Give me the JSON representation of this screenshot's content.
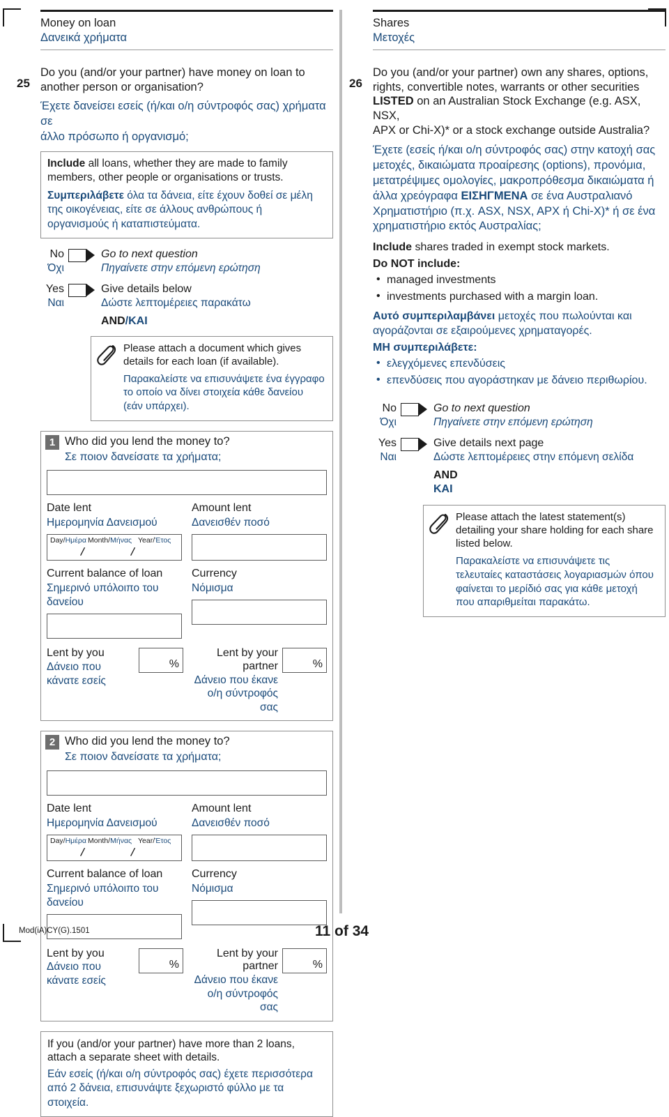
{
  "left": {
    "section": {
      "title_en": "Money on loan",
      "title_el": "Δανεικά χρήματα"
    },
    "question": {
      "number": "25",
      "text_en_1": "Do you (and/or your partner) have money on loan to",
      "text_en_2": "another person or organisation?",
      "text_el_1": "Έχετε δανείσει εσείς (ή/και ο/η σύντροφός σας) χρήματα σε",
      "text_el_2": "άλλο πρόσωπο ή οργανισμό;"
    },
    "include_box": {
      "en_bold": "Include",
      "en_rest": " all loans, whether they are made to family members, other people or organisations or trusts.",
      "el_bold": "Συμπεριλάβετε",
      "el_rest": " όλα τα δάνεια, είτε έχουν δοθεί σε μέλη της οικογένειας, είτε σε άλλους ανθρώπους ή οργανισμούς ή καταπιστεύματα."
    },
    "answers": {
      "no_en": "No",
      "no_el": "Όχι",
      "no_action_en": "Go to next question",
      "no_action_el": "Πηγαίνετε στην επόμενη ερώτηση",
      "yes_en": "Yes",
      "yes_el": "Ναι",
      "yes_action_en": "Give details below",
      "yes_action_el": "Δώστε λεπτομέρειες παρακάτω",
      "and_en": "AND",
      "and_el": "/ΚΑΙ"
    },
    "attach": {
      "icon": "paperclip-icon",
      "en": "Please attach a document which gives details for each loan (if available).",
      "el": "Παρακαλείστε να επισυνάψετε ένα έγγραφο το οποίο να δίνει στοιχεία κάθε δανείου (εάν υπάρχει)."
    },
    "entries": [
      {
        "badge": "1",
        "q_en": "Who did you lend the money to?",
        "q_el": "Σε ποιον δανείσατε τα χρήματα;",
        "recipient_value": "",
        "date_label_en": "Date lent",
        "date_label_el": "Ημερομηνία Δανεισμού",
        "day_en": "Day/",
        "day_el": "Ημέρα",
        "month_en": "Month/",
        "month_el": "Μήνας",
        "year_en": "Year/",
        "year_el": "Έτος",
        "date_value": "",
        "amount_label_en": "Amount lent",
        "amount_label_el": "Δανεισθέν ποσό",
        "amount_value": "",
        "balance_label_en": "Current balance of loan",
        "balance_label_el": "Σημερινό υπόλοιπο του δανείου",
        "balance_value": "",
        "currency_label_en": "Currency",
        "currency_label_el": "Νόμισμα",
        "currency_value": "",
        "lent_you_en": "Lent by you",
        "lent_you_el_1": "Δάνειο που",
        "lent_you_el_2": "κάνατε εσείς",
        "lent_you_value": "",
        "lent_partner_en": "Lent by your partner",
        "lent_partner_el_1": "Δάνειο που έκανε",
        "lent_partner_el_2": "ο/η σύντροφός σας",
        "lent_partner_value": "",
        "percent_symbol": "%"
      },
      {
        "badge": "2",
        "q_en": "Who did you lend the money to?",
        "q_el": "Σε ποιον δανείσατε τα χρήματα;",
        "recipient_value": "",
        "date_label_en": "Date lent",
        "date_label_el": "Ημερομηνία Δανεισμού",
        "day_en": "Day/",
        "day_el": "Ημέρα",
        "month_en": "Month/",
        "month_el": "Μήνας",
        "year_en": "Year/",
        "year_el": "Έτος",
        "date_value": "",
        "amount_label_en": "Amount lent",
        "amount_label_el": "Δανεισθέν ποσό",
        "amount_value": "",
        "balance_label_en": "Current balance of loan",
        "balance_label_el": "Σημερινό υπόλοιπο του δανείου",
        "balance_value": "",
        "currency_label_en": "Currency",
        "currency_label_el": "Νόμισμα",
        "currency_value": "",
        "lent_you_en": "Lent by you",
        "lent_you_el_1": "Δάνειο που",
        "lent_you_el_2": "κάνατε εσείς",
        "lent_you_value": "",
        "lent_partner_en": "Lent by your partner",
        "lent_partner_el_1": "Δάνειο που έκανε",
        "lent_partner_el_2": "ο/η σύντροφός σας",
        "lent_partner_value": "",
        "percent_symbol": "%"
      }
    ],
    "footnote": {
      "en": "If you (and/or your partner) have more than 2 loans, attach a separate sheet with details.",
      "el": "Εάν εσείς (ή/και ο/η σύντροφός σας) έχετε περισσότερα από 2 δάνεια, επισυνάψτε ξεχωριστό φύλλο με τα στοιχεία."
    }
  },
  "right": {
    "section": {
      "title_en": "Shares",
      "title_el": "Μετοχές"
    },
    "question": {
      "number": "26",
      "text_en_1": "Do you (and/or your partner) own any shares, options,",
      "text_en_2": "rights, convertible notes, warrants or other securities",
      "text_en_bold": "LISTED",
      "text_en_3": " on an Australian Stock Exchange (e.g. ASX, NSX,",
      "text_en_4": "APX or Chi-X)* or a stock exchange outside Australia?",
      "text_el_a": "Έχετε (εσείς ή/και ο/η σύντροφός σας) στην κατοχή σας μετοχές, δικαιώματα προαίρεσης (options), προνόμια, μετατρέψιμες ομολογίες, μακροπρόθεσμα δικαιώματα ή άλλα χρεόγραφα ",
      "text_el_bold": "ΕΙΣΗΓΜΕΝΑ",
      "text_el_b": " σε ένα Αυστραλιανό Χρηματιστήριο (π.χ. ASX, NSX, APX ή Chi-X)* ή σε ένα χρηματιστήριο εκτός Αυστραλίας;"
    },
    "include_block": {
      "en_bold": "Include",
      "en_rest": " shares traded in exempt stock markets.",
      "en_not_header": "Do NOT include:",
      "en_bullets": [
        "managed investments",
        "investments purchased with a margin loan."
      ],
      "el_bold": "Αυτό συμπεριλαμβάνει",
      "el_rest": " μετοχές που πωλούνται και αγοράζονται σε εξαιρούμενες χρηματαγορές.",
      "el_not_header": "ΜΗ συμπεριλάβετε:",
      "el_bullets": [
        "ελεγχόμενες επενδύσεις",
        "επενδύσεις που αγοράστηκαν με δάνειο περιθωρίου."
      ]
    },
    "answers": {
      "no_en": "No",
      "no_el": "Όχι",
      "no_action_en": "Go to next question",
      "no_action_el": "Πηγαίνετε στην επόμενη ερώτηση",
      "yes_en": "Yes",
      "yes_el": "Ναι",
      "yes_action_en": "Give details next page",
      "yes_action_el": "Δώστε λεπτομέρειες στην επόμενη σελίδα",
      "and_en": "AND",
      "and_el": "ΚΑΙ"
    },
    "attach": {
      "icon": "paperclip-icon",
      "en": "Please attach the latest statement(s) detailing your share holding for each share listed below.",
      "el": "Παρακαλείστε να επισυνάψετε τις τελευταίες καταστάσεις λογαριασμών όπου φαίνεται το μερίδιό σας για κάθε μετοχή που απαριθμείται παρακάτω."
    }
  },
  "footer": {
    "form_code": "Mod(iA)CY(G).1501",
    "page_number": "11 of 34"
  },
  "colors": {
    "greek_blue": "#1a4a7a",
    "black": "#1b1b1b",
    "badge_gray": "#6d6d6d",
    "rule_gray": "#9a9a9a"
  }
}
